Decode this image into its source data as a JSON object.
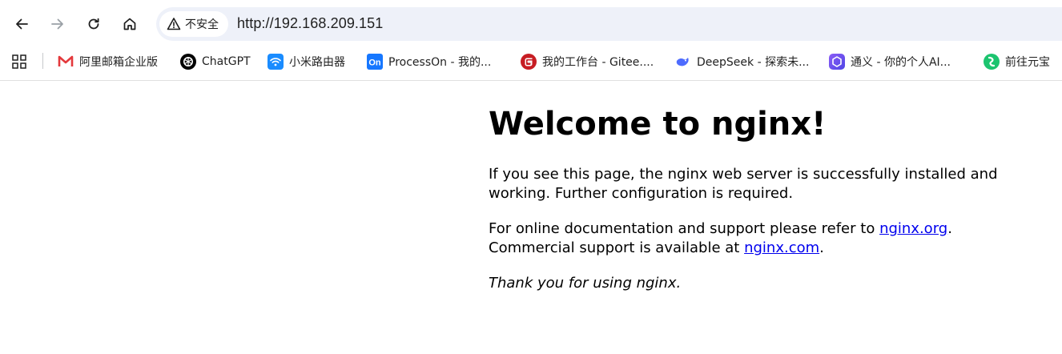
{
  "browser": {
    "security_label": "不安全",
    "url": "http://192.168.209.151",
    "nav": {
      "back_icon": "arrow-left-icon",
      "forward_icon": "arrow-right-icon",
      "reload_icon": "reload-icon",
      "home_icon": "home-icon"
    },
    "bookmarks": [
      {
        "label": "阿里邮箱企业版",
        "icon": "aliyun-mail-icon",
        "color": "#e4393c"
      },
      {
        "label": "ChatGPT",
        "icon": "chatgpt-icon",
        "color": "#000000"
      },
      {
        "label": "小米路由器",
        "icon": "wifi-icon",
        "color": "#1a8cff"
      },
      {
        "label": "ProcessOn - 我的...",
        "icon": "processon-icon",
        "color": "#1677ff"
      },
      {
        "label": "我的工作台 - Gitee....",
        "icon": "gitee-icon",
        "color": "#c71d23"
      },
      {
        "label": "DeepSeek - 探索未...",
        "icon": "deepseek-icon",
        "color": "#4d6bfe"
      },
      {
        "label": "通义 - 你的个人AI...",
        "icon": "tongyi-icon",
        "color": "#6b5cff"
      },
      {
        "label": "前往元宝",
        "icon": "yuanbao-icon",
        "color": "#1cc46f"
      }
    ]
  },
  "page": {
    "title": "Welcome to nginx!",
    "intro": "If you see this page, the nginx web server is successfully installed and working. Further configuration is required.",
    "docs_prefix": "For online documentation and support please refer to ",
    "docs_link": "nginx.org",
    "docs_mid": ".",
    "commercial_prefix": "Commercial support is available at ",
    "commercial_link": "nginx.com",
    "commercial_suffix": ".",
    "thanks": "Thank you for using nginx."
  },
  "colors": {
    "link": "#0000ee",
    "omnibox_bg": "#eef1f9"
  }
}
